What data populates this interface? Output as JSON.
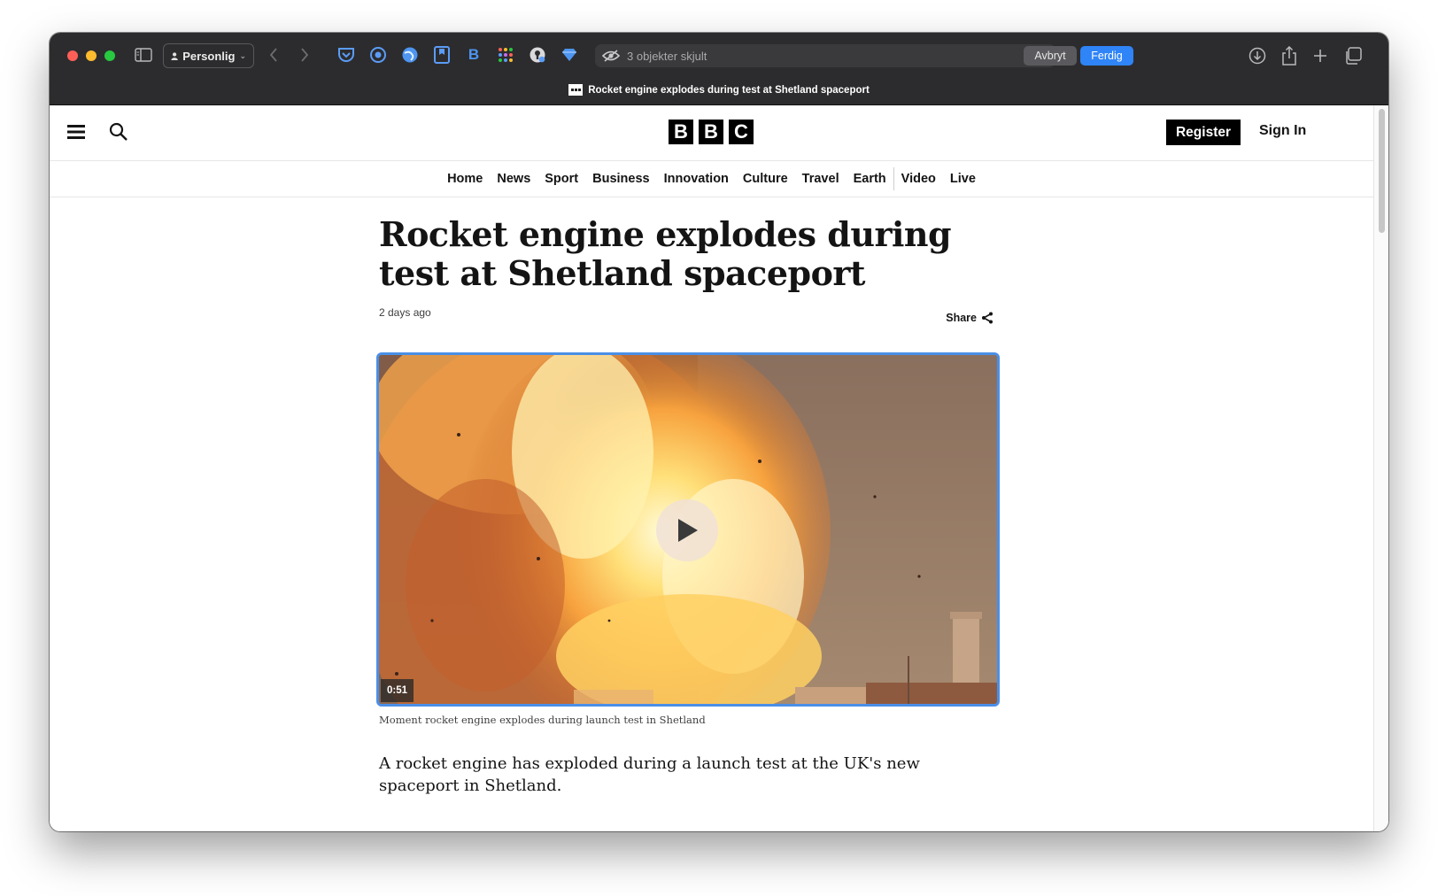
{
  "browser": {
    "profile_label": "Personlig",
    "address_text": "3 objekter skjult",
    "cancel_label": "Avbryt",
    "done_label": "Ferdig",
    "tab_title": "Rocket engine explodes during test at Shetland spaceport",
    "extension_b_label": "B"
  },
  "site": {
    "logo_letters": [
      "B",
      "B",
      "C"
    ],
    "register_label": "Register",
    "signin_label": "Sign In",
    "nav": [
      "Home",
      "News",
      "Sport",
      "Business",
      "Innovation",
      "Culture",
      "Travel",
      "Earth",
      "Video",
      "Live"
    ]
  },
  "article": {
    "headline": "Rocket engine explodes during test at Shetland spaceport",
    "timestamp": "2 days ago",
    "share_label": "Share",
    "video_duration": "0:51",
    "caption": "Moment rocket engine explodes during launch test in Shetland",
    "lead": "A rocket engine has exploded during a launch test at the UK's new spaceport in Shetland."
  },
  "colors": {
    "chrome_bg": "#2c2c2e",
    "done_blue": "#2f84f7",
    "focus_ring": "#4a8fe7"
  }
}
